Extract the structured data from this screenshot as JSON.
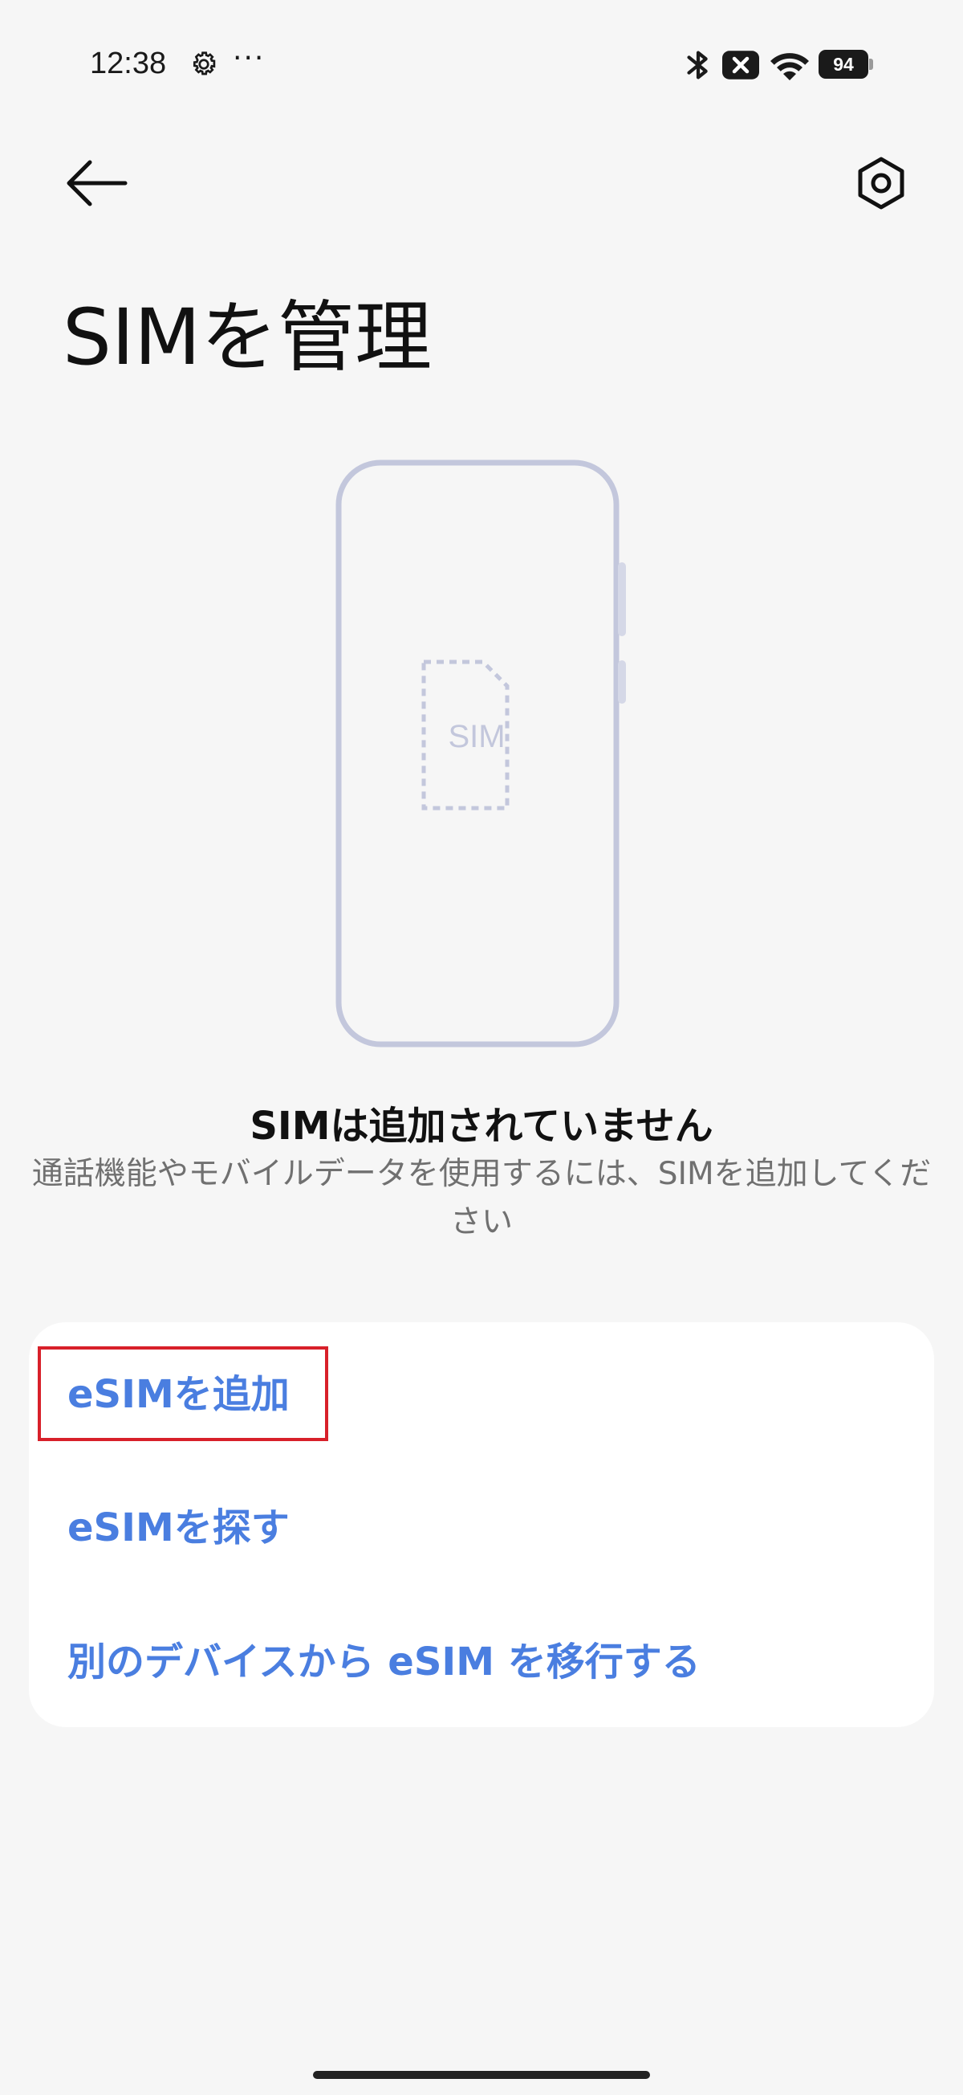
{
  "status_bar": {
    "time": "12:38",
    "more": "···",
    "battery": "94"
  },
  "header": {
    "title": "SIMを管理"
  },
  "illustration": {
    "sim_label": "SIM",
    "frame_color": "#c3c7dc"
  },
  "empty_state": {
    "title": "SIMは追加されていません",
    "subtitle": "通話機能やモバイルデータを使用するには、SIMを追加してください"
  },
  "options": {
    "add_esim": "eSIMを追加",
    "find_esim": "eSIMを探す",
    "transfer_esim": "別のデバイスから eSIM を移行する"
  },
  "colors": {
    "accent": "#4a7ee0",
    "background": "#f6f6f6",
    "card": "#ffffff",
    "highlight": "#d8202a"
  }
}
